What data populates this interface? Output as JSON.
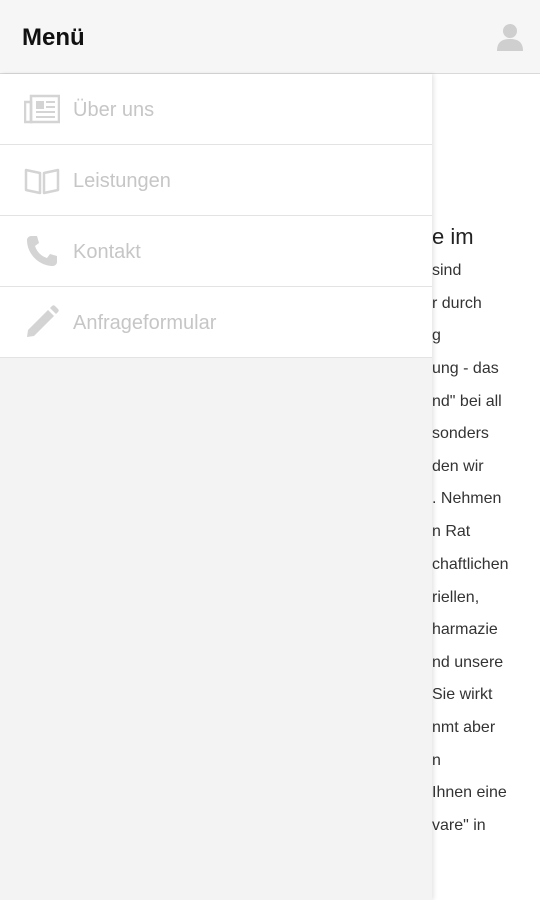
{
  "header": {
    "title": "Menü"
  },
  "menu": {
    "items": [
      {
        "label": "Über uns",
        "icon": "newspaper-icon"
      },
      {
        "label": "Leistungen",
        "icon": "book-icon"
      },
      {
        "label": "Kontakt",
        "icon": "phone-icon"
      },
      {
        "label": "Anfrageformular",
        "icon": "pencil-icon"
      }
    ]
  },
  "content": {
    "heading": "e im",
    "lines": [
      "sind",
      "r durch",
      "g",
      "ung - das",
      "nd\" bei all",
      "sonders",
      "den wir",
      ". Nehmen",
      "n Rat",
      "chaftlichen",
      "riellen,",
      "harmazie",
      "nd unsere",
      "Sie wirkt",
      "nmt aber",
      "n",
      "Ihnen eine",
      "vare\" in"
    ]
  },
  "colors": {
    "header_bg": "#f6f6f6",
    "drawer_bg": "#f3f3f3",
    "menu_label": "#c6c6c6",
    "icon": "#d4d4d4"
  }
}
